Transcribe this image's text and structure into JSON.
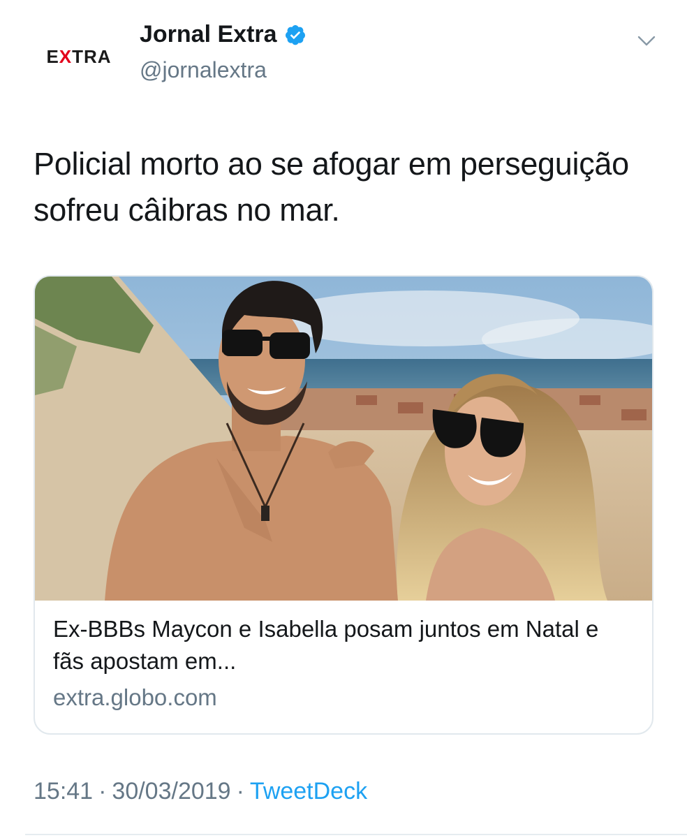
{
  "author": {
    "display_name": "Jornal Extra",
    "handle": "@jornalextra",
    "avatar_logo_left": "E",
    "avatar_logo_x": "X",
    "avatar_logo_right": "TRA",
    "verified": true,
    "verified_color": "#1da1f2"
  },
  "tweet": {
    "text": "Policial morto ao se afogar em perseguição sofreu câibras no mar."
  },
  "card": {
    "title": "Ex-BBBs Maycon e Isabella posam juntos em Natal e fãs apostam em...",
    "domain": "extra.globo.com"
  },
  "meta": {
    "time": "15:41",
    "separator1": "·",
    "date": "30/03/2019",
    "separator2": "·",
    "source": "TweetDeck"
  },
  "icons": {
    "menu": "chevron-down-icon",
    "verified": "verified-badge-icon"
  },
  "colors": {
    "text_primary": "#14171a",
    "text_secondary": "#657786",
    "link": "#1da1f2",
    "brand_red": "#e3001b"
  }
}
